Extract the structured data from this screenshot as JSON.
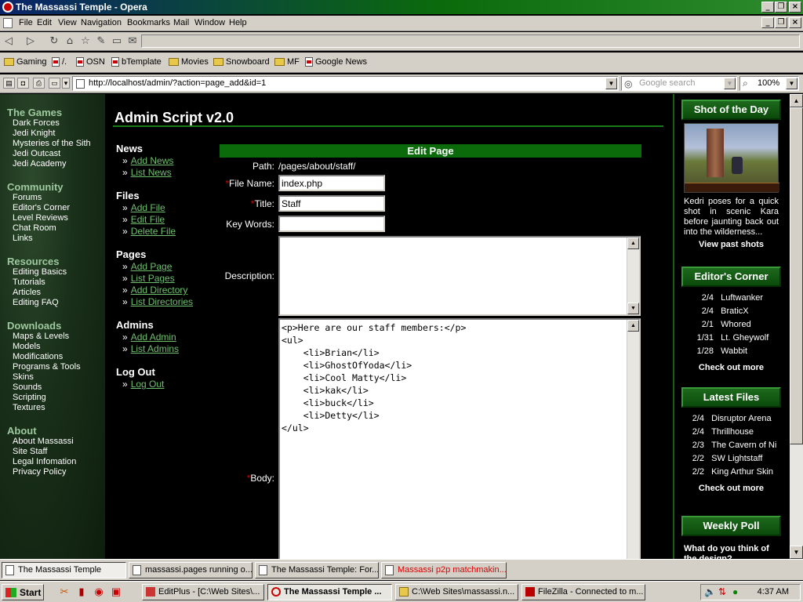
{
  "window": {
    "title": "The Massassi Temple - Opera"
  },
  "menubar": [
    "File",
    "Edit",
    "View",
    "Navigation",
    "Bookmarks",
    "Mail",
    "Window",
    "Help"
  ],
  "bookmarks": [
    "Gaming",
    "/.",
    "OSN",
    "bTemplate",
    "Movies",
    "Snowboard",
    "MF",
    "Google News"
  ],
  "address": {
    "url": "http://localhost/admin/?action=page_add&id=1",
    "search_placeholder": "Google search",
    "zoom": "100%"
  },
  "leftnav": {
    "sections": [
      {
        "title": "The Games",
        "links": [
          "Dark Forces",
          "Jedi Knight",
          "Mysteries of the Sith",
          "Jedi Outcast",
          "Jedi Academy"
        ]
      },
      {
        "title": "Community",
        "links": [
          "Forums",
          "Editor's Corner",
          "Level Reviews",
          "Chat Room",
          "Links"
        ]
      },
      {
        "title": "Resources",
        "links": [
          "Editing Basics",
          "Tutorials",
          "Articles",
          "Editing FAQ"
        ]
      },
      {
        "title": "Downloads",
        "links": [
          "Maps & Levels",
          "Models",
          "Modifications",
          "Programs & Tools",
          "Skins",
          "Sounds",
          "Scripting",
          "Textures"
        ]
      },
      {
        "title": "About",
        "links": [
          "About Massassi",
          "Site Staff",
          "Legal Infomation",
          "Privacy Policy"
        ]
      }
    ]
  },
  "main": {
    "title": "Admin Script v2.0"
  },
  "admin_menu": [
    {
      "title": "News",
      "links": [
        "Add News",
        "List News"
      ]
    },
    {
      "title": "Files",
      "links": [
        "Add File",
        "Edit File",
        "Delete File"
      ]
    },
    {
      "title": "Pages",
      "links": [
        "Add Page",
        "List Pages",
        "Add Directory",
        "List Directories"
      ]
    },
    {
      "title": "Admins",
      "links": [
        "Add Admin",
        "List Admins"
      ]
    },
    {
      "title": "Log Out",
      "links": [
        "Log Out"
      ]
    }
  ],
  "form": {
    "heading": "Edit Page",
    "path_label": "Path:",
    "path_value": "/pages/about/staff/",
    "filename_label": "File Name:",
    "filename_value": "index.php",
    "title_label": "Title:",
    "title_value": "Staff",
    "keywords_label": "Key Words:",
    "keywords_value": "",
    "description_label": "Description:",
    "body_label": "Body:",
    "body_value": "<p>Here are our staff members:</p>\n<ul>\n    <li>Brian</li>\n    <li>GhostOfYoda</li>\n    <li>Cool Matty</li>\n    <li>kak</li>\n    <li>buck</li>\n    <li>Detty</li>\n</ul>"
  },
  "sidebar": {
    "shot_title": "Shot of the Day",
    "shot_caption": "Kedri poses for a quick shot in scenic Kara before jaunting back out into the wilderness...",
    "shot_link": "View past shots",
    "editors_title": "Editor's Corner",
    "editors": [
      {
        "date": "2/4",
        "name": "Luftwanker"
      },
      {
        "date": "2/4",
        "name": "BraticX"
      },
      {
        "date": "2/1",
        "name": "Whored"
      },
      {
        "date": "1/31",
        "name": "Lt. Gheywolf"
      },
      {
        "date": "1/28",
        "name": "Wabbit"
      }
    ],
    "editors_more": "Check out more",
    "files_title": "Latest Files",
    "files": [
      {
        "date": "2/4",
        "name": "Disruptor Arena"
      },
      {
        "date": "2/4",
        "name": "Thrillhouse"
      },
      {
        "date": "2/3",
        "name": "The Cavern of Ni"
      },
      {
        "date": "2/2",
        "name": "SW Lightstaff"
      },
      {
        "date": "2/2",
        "name": "King Arthur Skin"
      }
    ],
    "files_more": "Check out more",
    "poll_title": "Weekly Poll",
    "poll_question": "What do you think of the design?"
  },
  "opera_tabs": [
    "The Massassi Temple",
    "massassi.pages running o...",
    "The Massassi Temple: For...",
    "Massassi p2p matchmakin..."
  ],
  "taskbar": {
    "start": "Start",
    "buttons": [
      "EditPlus - [C:\\Web Sites\\...",
      "The Massassi Temple ...",
      "C:\\Web Sites\\massassi.n...",
      "FileZilla - Connected to m..."
    ],
    "clock": "4:37 AM"
  }
}
